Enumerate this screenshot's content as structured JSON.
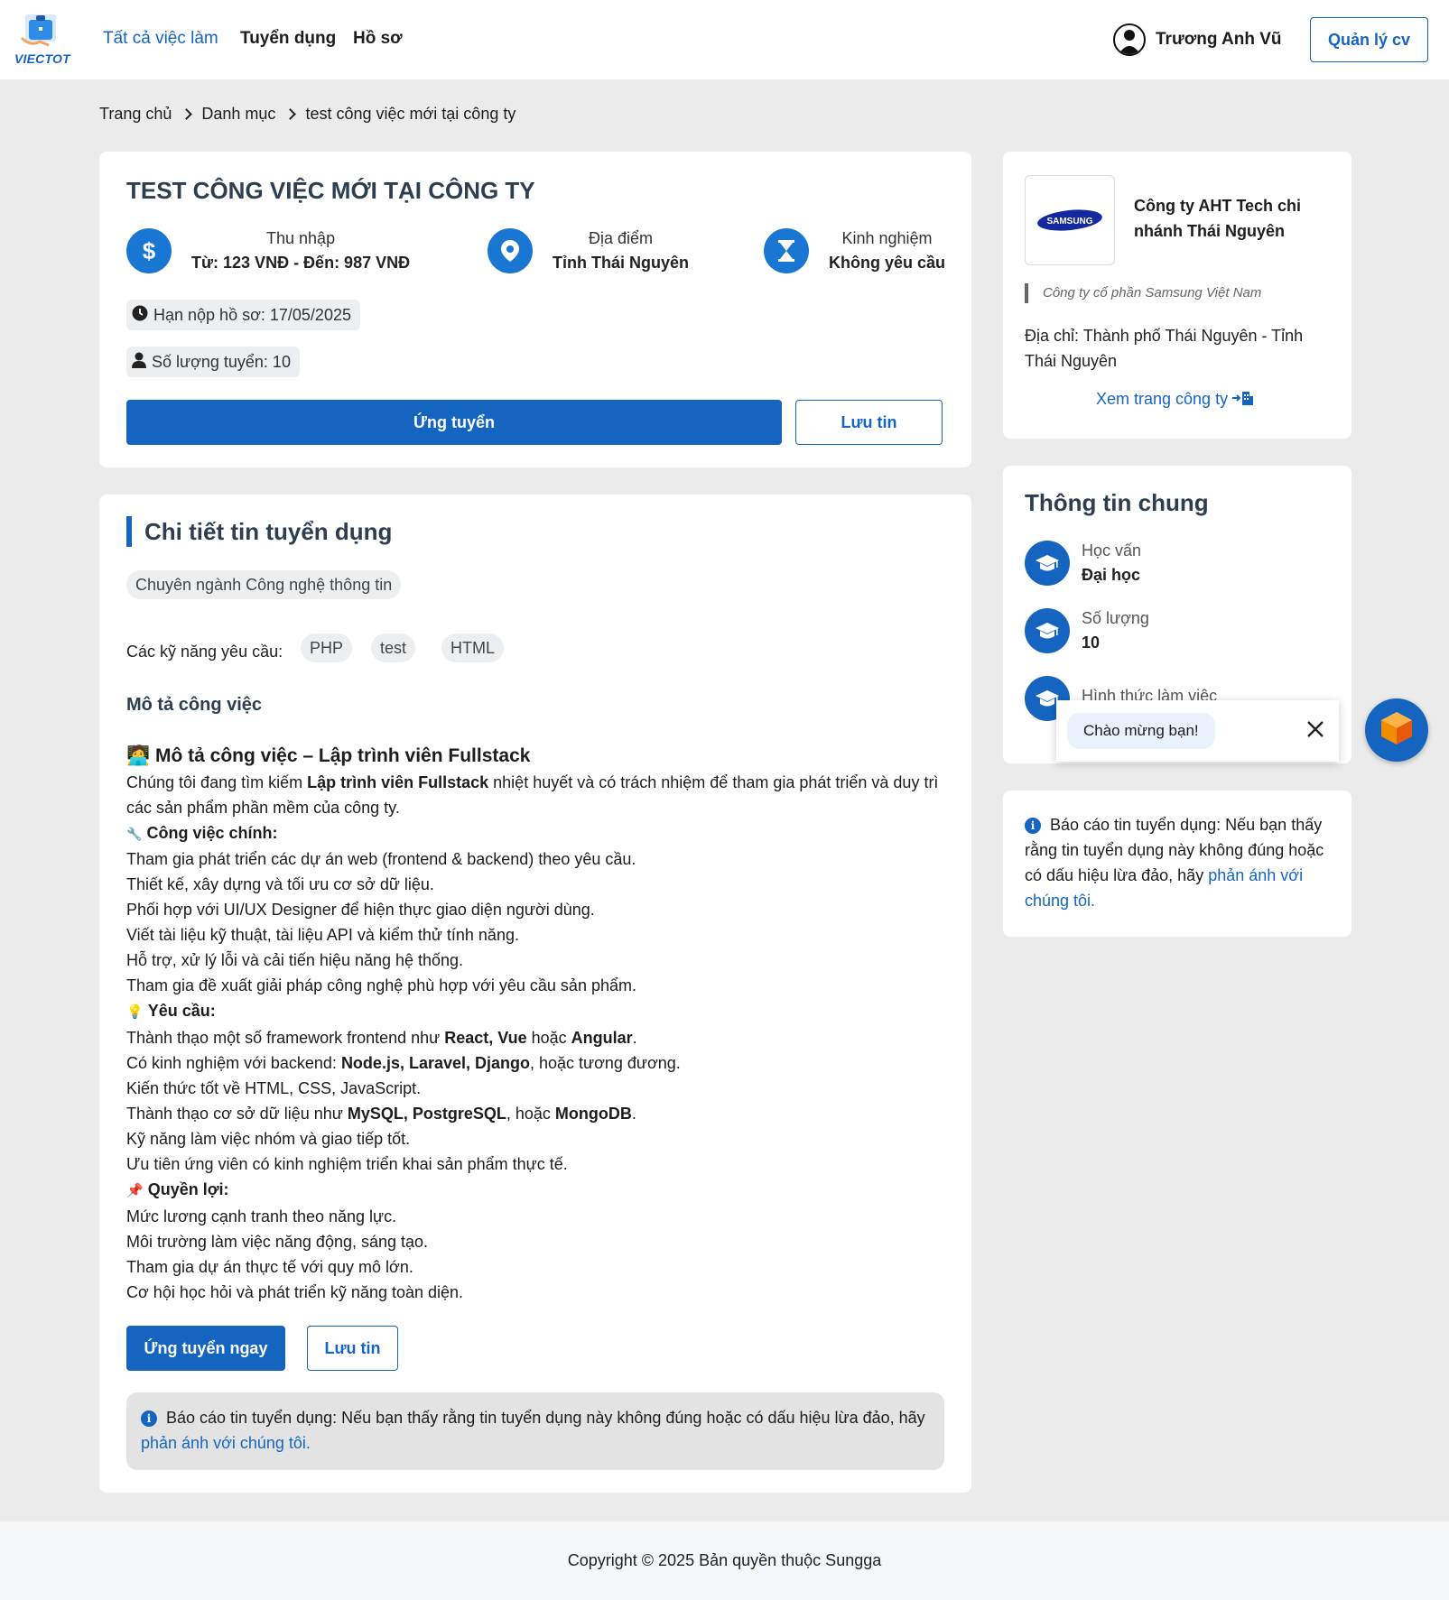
{
  "header": {
    "logo_text": "VIECTOT",
    "nav": [
      "Tất cả việc làm",
      "Tuyển dụng",
      "Hồ sơ"
    ],
    "user_name": "Trương Anh Vũ",
    "manage_button": "Quản lý cv"
  },
  "breadcrumb": [
    "Trang chủ",
    "Danh mục",
    "test công việc mới tại công ty"
  ],
  "job": {
    "title": "TEST CÔNG VIỆC MỚI TẠI CÔNG TY",
    "income_label": "Thu nhập",
    "income_value": "Từ: 123 VNĐ - Đến: 987 VNĐ",
    "location_label": "Địa điểm",
    "location_value": "Tỉnh Thái Nguyên",
    "experience_label": "Kinh nghiệm",
    "experience_value": "Không yêu cầu",
    "deadline": "Hạn nộp hồ sơ: 17/05/2025",
    "quantity": "Số lượng tuyển: 10",
    "apply_button": "Ứng tuyển",
    "save_button": "Lưu tin"
  },
  "detail": {
    "section_title": "Chi tiết tin tuyển dụng",
    "category": "Chuyên ngành Công nghệ thông tin",
    "skills_label": "Các kỹ năng yêu cầu:",
    "skills": [
      "PHP",
      "test",
      "HTML"
    ],
    "description_heading": "Mô tả công việc",
    "content_title": "Mô tả công việc – Lập trình viên Fullstack",
    "intro_pre": "Chúng tôi đang tìm kiếm ",
    "intro_bold": "Lập trình viên Fullstack",
    "intro_post": " nhiệt huyết và có trách nhiệm để tham gia phát triển và duy trì các sản phẩm phần mềm của công ty.",
    "main_tasks_title": "Công việc chính:",
    "main_tasks": [
      "Tham gia phát triển các dự án web (frontend & backend) theo yêu cầu.",
      "Thiết kế, xây dựng và tối ưu cơ sở dữ liệu.",
      "Phối hợp với UI/UX Designer để hiện thực giao diện người dùng.",
      "Viết tài liệu kỹ thuật, tài liệu API và kiểm thử tính năng.",
      "Hỗ trợ, xử lý lỗi và cải tiến hiệu năng hệ thống.",
      "Tham gia đề xuất giải pháp công nghệ phù hợp với yêu cầu sản phẩm."
    ],
    "requirements_title": "Yêu cầu:",
    "req1_pre": "Thành thạo một số framework frontend như ",
    "req1_b1": "React, Vue",
    "req1_mid": " hoặc ",
    "req1_b2": "Angular",
    "req1_post": ".",
    "req2_pre": "Có kinh nghiệm với backend: ",
    "req2_b": "Node.js, Laravel, Django",
    "req2_post": ", hoặc tương đương.",
    "req3": "Kiến thức tốt về HTML, CSS, JavaScript.",
    "req4_pre": "Thành thạo cơ sở dữ liệu như ",
    "req4_b1": "MySQL, PostgreSQL",
    "req4_mid": ", hoặc ",
    "req4_b2": "MongoDB",
    "req4_post": ".",
    "req5": "Kỹ năng làm việc nhóm và giao tiếp tốt.",
    "req6": "Ưu tiên ứng viên có kinh nghiệm triển khai sản phẩm thực tế.",
    "benefits_title": "Quyền lợi:",
    "benefits": [
      "Mức lương cạnh tranh theo năng lực.",
      "Môi trường làm việc năng động, sáng tạo.",
      "Tham gia dự án thực tế với quy mô lớn.",
      "Cơ hội học hỏi và phát triển kỹ năng toàn diện."
    ],
    "apply_now_button": "Ứng tuyển ngay",
    "save_button": "Lưu tin",
    "report_text": "Báo cáo tin tuyển dụng: Nếu bạn thấy rằng tin tuyển dụng này không đúng hoặc có dấu hiệu lừa đảo, hãy ",
    "report_link": "phản ánh với chúng tôi."
  },
  "company": {
    "logo_text": "SAMSUNG",
    "name": "Công ty AHT Tech chi nhánh Thái Nguyên",
    "parent": "Công ty cổ phần Samsung Việt Nam",
    "address": "Địa chỉ: Thành phố Thái Nguyên - Tỉnh Thái Nguyên",
    "view_link": "Xem trang công ty"
  },
  "general_info": {
    "title": "Thông tin chung",
    "items": [
      {
        "label": "Học vấn",
        "value": "Đại học"
      },
      {
        "label": "Số lượng",
        "value": "10"
      },
      {
        "label": "Hình thức làm việc",
        "value": ""
      }
    ]
  },
  "side_report": {
    "text": "Báo cáo tin tuyển dụng: Nếu bạn thấy rằng tin tuyển dụng này không đúng hoặc có dấu hiệu lừa đảo, hãy ",
    "link": "phản ánh với chúng tôi."
  },
  "chat": {
    "greeting": "Chào mừng bạn!"
  },
  "footer": {
    "text": "Copyright © 2025 Bản quyền thuộc Sungga"
  },
  "colors": {
    "primary": "#1565c0",
    "icon_blue": "#1976d2",
    "page_bg": "#ebebeb"
  }
}
